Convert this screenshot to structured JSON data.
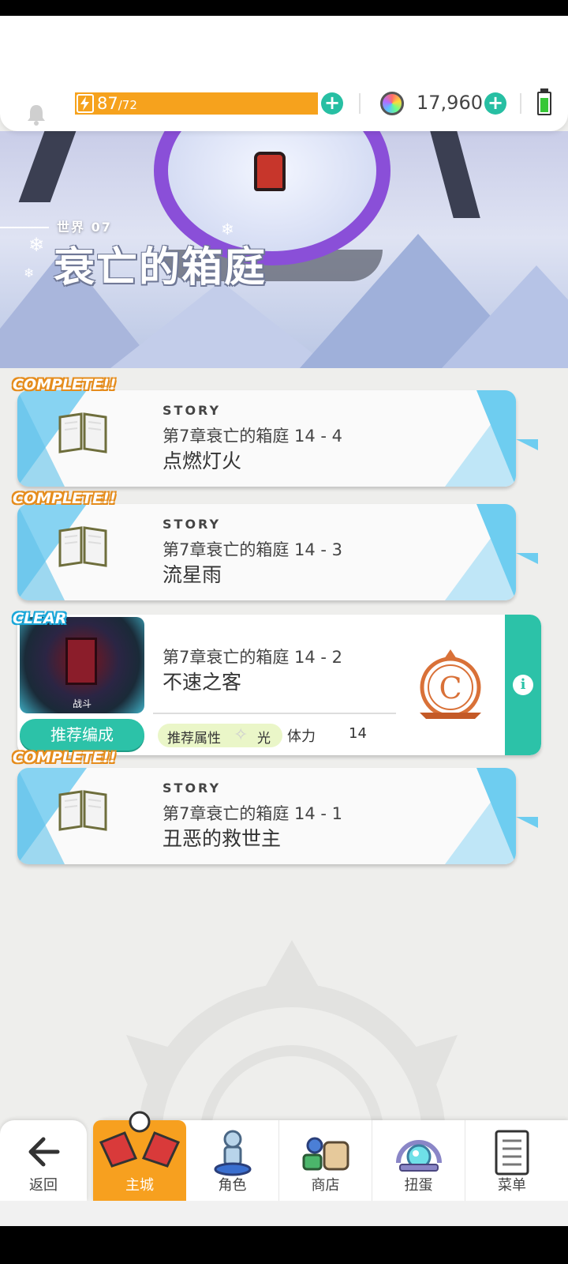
{
  "topbar": {
    "stamina_current": "87",
    "stamina_max": "/72",
    "gems": "17,960"
  },
  "banner": {
    "world_label": "世界 07",
    "world_title": "衰亡的箱庭"
  },
  "stages": [
    {
      "badge": "COMPLETE!!",
      "type": "STORY",
      "chapter": "第7章衰亡的箱庭 14 - 4",
      "title": "点燃灯火"
    },
    {
      "badge": "COMPLETE!!",
      "type": "STORY",
      "chapter": "第7章衰亡的箱庭 14 - 3",
      "title": "流星雨"
    },
    {
      "badge": "CLEAR",
      "chapter": "第7章衰亡的箱庭 14 - 2",
      "title": "不速之客",
      "thumb_label": "战斗",
      "team_button": "推荐编成",
      "attr_label": "推荐属性",
      "attr_value": "光",
      "cost_label": "体力",
      "cost_value": "14",
      "rank": "C"
    },
    {
      "badge": "COMPLETE!!",
      "type": "STORY",
      "chapter": "第7章衰亡的箱庭 14 - 1",
      "title": "丑恶的救世主"
    }
  ],
  "nav": {
    "back": "返回",
    "items": [
      "主城",
      "角色",
      "商店",
      "扭蛋",
      "菜单"
    ]
  },
  "colors": {
    "accent_teal": "#2cc2a8",
    "stamina_orange": "#f6a21d",
    "story_blue": "#6ecdf0"
  }
}
